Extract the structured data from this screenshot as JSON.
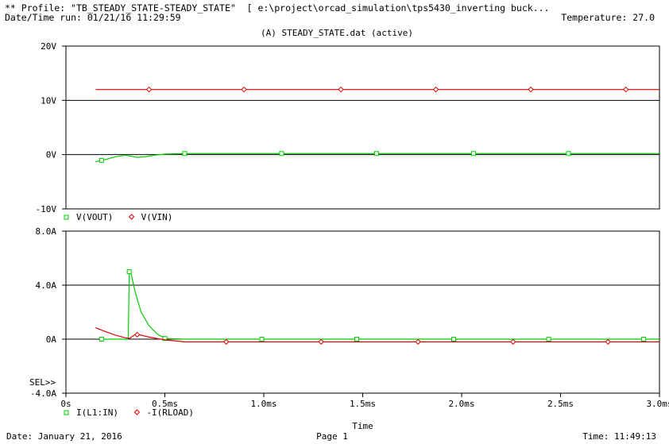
{
  "header": {
    "profile_line": "** Profile: \"TB_STEADY_STATE-STEADY_STATE\"  [ e:\\project\\orcad_simulation\\tps5430_inverting buck...",
    "run_line": "Date/Time run: 01/21/16 11:29:59",
    "temperature": "Temperature: 27.0",
    "plot_title": "(A) STEADY_STATE.dat (active)"
  },
  "footer": {
    "date": "Date: January 21, 2016",
    "page": "Page 1",
    "time": "Time: 11:49:13"
  },
  "colors": {
    "green": "#00cc00",
    "red": "#dd0000",
    "grid": "#000000"
  },
  "chart_data": [
    {
      "type": "line",
      "xlim": [
        0,
        3.0
      ],
      "ylim": [
        -10,
        20
      ],
      "yticks": [
        -10,
        0,
        10,
        20
      ],
      "ytick_labels": [
        "-10V",
        "0V",
        "10V",
        "20V"
      ],
      "grid": "horizontal",
      "sel_marker": "",
      "series": [
        {
          "name": "V(VOUT)",
          "color": "#00cc00",
          "marker": "square",
          "points": [
            [
              0.15,
              -1.3
            ],
            [
              0.2,
              -0.9
            ],
            [
              0.25,
              -0.4
            ],
            [
              0.3,
              -0.1
            ],
            [
              0.33,
              -0.3
            ],
            [
              0.36,
              -0.5
            ],
            [
              0.4,
              -0.4
            ],
            [
              0.45,
              -0.1
            ],
            [
              0.5,
              0.1
            ],
            [
              0.6,
              0.2
            ],
            [
              1.0,
              0.2
            ],
            [
              1.5,
              0.2
            ],
            [
              2.0,
              0.2
            ],
            [
              2.5,
              0.2
            ],
            [
              3.0,
              0.2
            ]
          ],
          "marker_x": [
            0.18,
            0.6,
            1.09,
            1.57,
            2.06,
            2.54
          ]
        },
        {
          "name": "V(VIN)",
          "color": "#dd0000",
          "marker": "diamond",
          "points": [
            [
              0.15,
              12
            ],
            [
              3.0,
              12
            ]
          ],
          "marker_x": [
            0.42,
            0.9,
            1.39,
            1.87,
            2.35,
            2.83
          ]
        }
      ]
    },
    {
      "type": "line",
      "xlim": [
        0,
        3.0
      ],
      "ylim": [
        -4.0,
        8.0
      ],
      "yticks": [
        -4.0,
        0,
        4.0,
        8.0
      ],
      "ytick_labels": [
        "-4.0A",
        "0A",
        "4.0A",
        "8.0A"
      ],
      "xticks": [
        0,
        0.5,
        1.0,
        1.5,
        2.0,
        2.5,
        3.0
      ],
      "xtick_labels": [
        "0s",
        "0.5ms",
        "1.0ms",
        "1.5ms",
        "2.0ms",
        "2.5ms",
        "3.0ms"
      ],
      "xlabel": "Time",
      "grid": "horizontal",
      "sel_marker": "SEL>>",
      "series": [
        {
          "name": "I(L1:IN)",
          "color": "#00cc00",
          "marker": "square",
          "points": [
            [
              0.18,
              0
            ],
            [
              0.3,
              0
            ],
            [
              0.315,
              0
            ],
            [
              0.32,
              5.0
            ],
            [
              0.33,
              4.8
            ],
            [
              0.35,
              3.5
            ],
            [
              0.38,
              2.0
            ],
            [
              0.42,
              1.0
            ],
            [
              0.46,
              0.4
            ],
            [
              0.5,
              0.05
            ],
            [
              0.6,
              0
            ],
            [
              1.0,
              0
            ],
            [
              1.5,
              0
            ],
            [
              2.0,
              0
            ],
            [
              2.5,
              0
            ],
            [
              3.0,
              0
            ]
          ],
          "marker_x": [
            0.18,
            0.32,
            0.5,
            0.99,
            1.47,
            1.96,
            2.44,
            2.92
          ]
        },
        {
          "name": "-I(RLOAD)",
          "color": "#dd0000",
          "marker": "diamond",
          "points": [
            [
              0.15,
              0.85
            ],
            [
              0.2,
              0.55
            ],
            [
              0.25,
              0.3
            ],
            [
              0.3,
              0.1
            ],
            [
              0.32,
              0.05
            ],
            [
              0.35,
              0.35
            ],
            [
              0.38,
              0.3
            ],
            [
              0.42,
              0.15
            ],
            [
              0.46,
              0.05
            ],
            [
              0.5,
              -0.05
            ],
            [
              0.6,
              -0.2
            ],
            [
              1.0,
              -0.2
            ],
            [
              1.5,
              -0.2
            ],
            [
              2.0,
              -0.2
            ],
            [
              2.5,
              -0.2
            ],
            [
              3.0,
              -0.2
            ]
          ],
          "marker_x": [
            0.36,
            0.81,
            1.29,
            1.78,
            2.26,
            2.74
          ]
        }
      ]
    }
  ]
}
